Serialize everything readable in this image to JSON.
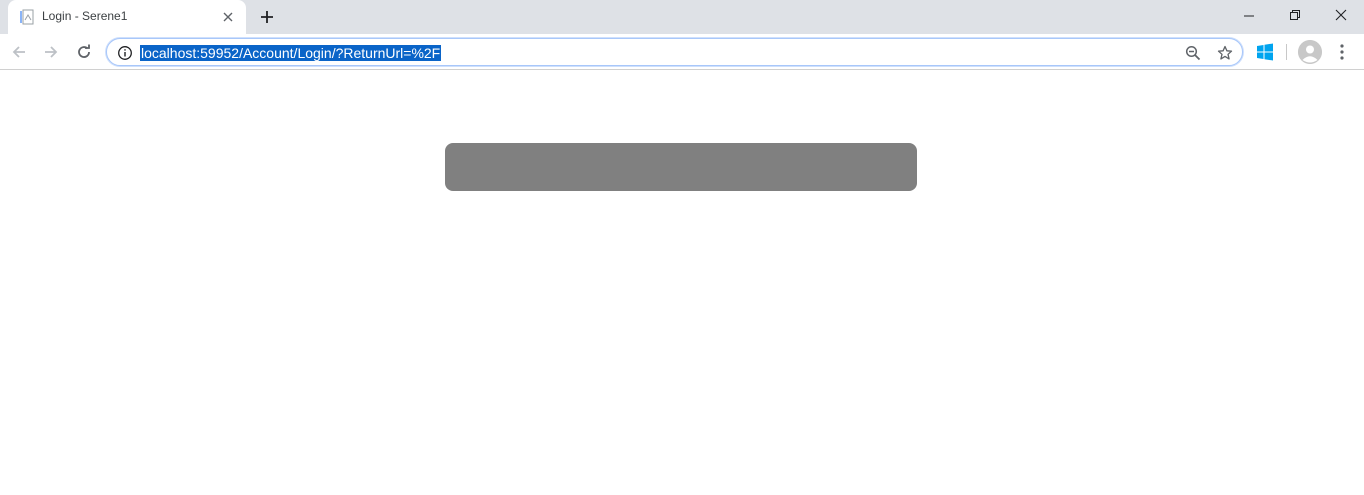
{
  "tab": {
    "title": "Login - Serene1",
    "favicon": "page-icon"
  },
  "toolbar": {
    "url": "localhost:59952/Account/Login/?ReturnUrl=%2F",
    "icons": [
      "back-arrow-icon",
      "forward-arrow-icon",
      "reload-icon",
      "info-icon",
      "zoom-out-icon",
      "star-icon",
      "windows-extension-icon",
      "profile-avatar-icon",
      "menu-dots-icon"
    ]
  },
  "window_controls": [
    "minimize-icon",
    "restore-icon",
    "close-icon"
  ],
  "colors": {
    "titlebar": "#dee1e6",
    "url_selection": "#0a64c8",
    "loading_block": "#808080",
    "windows_logo": "#00a4ef"
  }
}
